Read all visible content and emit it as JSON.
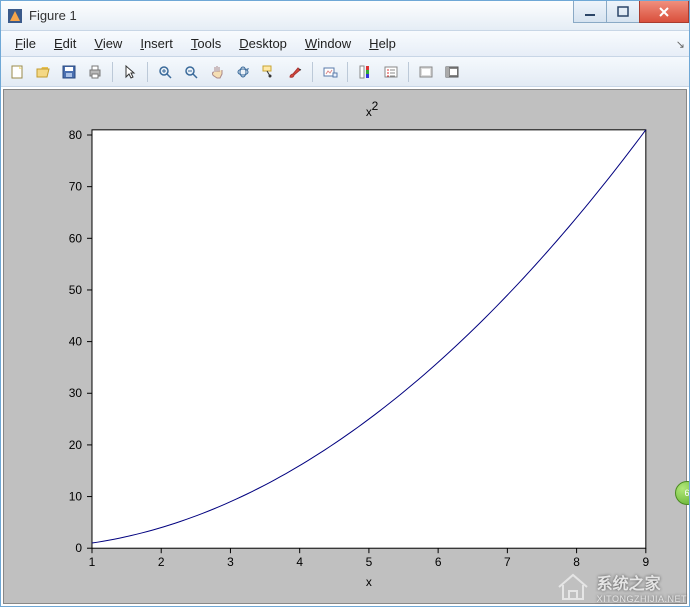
{
  "window": {
    "title": "Figure 1"
  },
  "menu": {
    "file": "File",
    "edit": "Edit",
    "view": "View",
    "insert": "Insert",
    "tools": "Tools",
    "desktop": "Desktop",
    "window": "Window",
    "help": "Help"
  },
  "toolbar": {
    "new": "New Figure",
    "open": "Open",
    "save": "Save",
    "print": "Print",
    "pointer": "Edit Plot",
    "zoomin": "Zoom In",
    "zoomout": "Zoom Out",
    "pan": "Pan",
    "rotate": "Rotate 3D",
    "datacursor": "Data Cursor",
    "brush": "Brush",
    "link": "Link Plot",
    "colorbar": "Insert Colorbar",
    "legend": "Insert Legend",
    "hide": "Hide Plot Tools",
    "show": "Show Plot Tools"
  },
  "chart_data": {
    "type": "line",
    "title": "x^2",
    "xlabel": "x",
    "ylabel": "",
    "x": [
      1,
      2,
      3,
      4,
      5,
      6,
      7,
      8,
      9
    ],
    "y": [
      1,
      4,
      9,
      16,
      25,
      36,
      49,
      64,
      81
    ],
    "x_ticks": [
      1,
      2,
      3,
      4,
      5,
      6,
      7,
      8,
      9
    ],
    "y_ticks": [
      0,
      10,
      20,
      30,
      40,
      50,
      60,
      70,
      80
    ],
    "xlim": [
      1,
      9
    ],
    "ylim": [
      0,
      81
    ],
    "line_color": "#00007f"
  },
  "watermark": {
    "name": "系统之家",
    "url": "XITONGZHIJIA.NET"
  }
}
